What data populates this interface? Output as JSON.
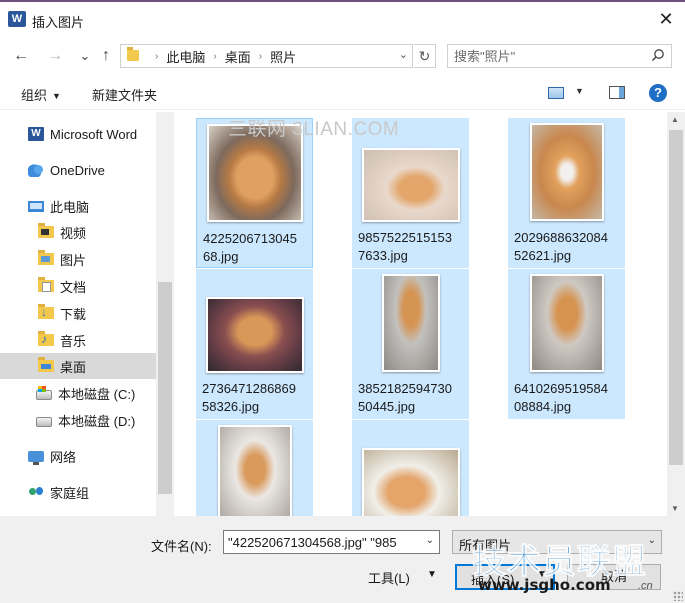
{
  "window": {
    "title": "插入图片",
    "close_glyph": "✕"
  },
  "address_bar": {
    "back_glyph": "←",
    "forward_glyph": "→",
    "recent_glyph": "⌄",
    "up_glyph": "↑",
    "breadcrumbs": [
      "此电脑",
      "桌面",
      "照片"
    ],
    "separator": "›",
    "dropdown_glyph": "⌄",
    "refresh_glyph": "↻"
  },
  "search": {
    "placeholder": "搜索\"照片\""
  },
  "toolbar": {
    "organize_label": "组织",
    "new_folder_label": "新建文件夹",
    "help_label": "?"
  },
  "sidebar": {
    "items": [
      {
        "label": "Microsoft Word",
        "icon": "word-icon"
      },
      {
        "label": "OneDrive",
        "icon": "onedrive-icon"
      },
      {
        "label": "此电脑",
        "icon": "computer-icon"
      },
      {
        "label": "视频",
        "icon": "videos-folder-icon"
      },
      {
        "label": "图片",
        "icon": "pictures-folder-icon"
      },
      {
        "label": "文档",
        "icon": "documents-folder-icon"
      },
      {
        "label": "下载",
        "icon": "downloads-folder-icon"
      },
      {
        "label": "音乐",
        "icon": "music-folder-icon"
      },
      {
        "label": "桌面",
        "icon": "desktop-folder-icon",
        "selected": true
      },
      {
        "label": "本地磁盘 (C:)",
        "icon": "windows-drive-icon"
      },
      {
        "label": "本地磁盘 (D:)",
        "icon": "drive-icon"
      },
      {
        "label": "网络",
        "icon": "network-icon"
      },
      {
        "label": "家庭组",
        "icon": "homegroup-icon"
      }
    ]
  },
  "files": [
    {
      "name": "422520671304568.jpg",
      "line1": "4225206713045",
      "line2": "68.jpg",
      "selected": true,
      "focused": true
    },
    {
      "name": "98575225151537633.jpg",
      "line1": "9857522515153",
      "line2": "7633.jpg",
      "selected": true
    },
    {
      "name": "202968863208452621.jpg",
      "line1": "2029688632084",
      "line2": "52621.jpg",
      "selected": true
    },
    {
      "name": "273647128686958326.jpg",
      "line1": "2736471286869",
      "line2": "58326.jpg",
      "selected": true
    },
    {
      "name": "385218259473050445.jpg",
      "line1": "3852182594730",
      "line2": "50445.jpg",
      "selected": true
    },
    {
      "name": "641026951958408884.jpg",
      "line1": "6410269519584",
      "line2": "08884.jpg",
      "selected": true
    },
    {
      "name": "",
      "line1": "",
      "line2": "",
      "selected": true
    },
    {
      "name": "",
      "line1": "",
      "line2": "",
      "selected": true
    }
  ],
  "watermark_top": "三联网 3LIAN.COM",
  "bottom": {
    "filename_label": "文件名(N):",
    "filename_value": "\"422520671304568.jpg\" \"985",
    "filetype_value": "所有图片",
    "tools_label": "工具(L)",
    "insert_label": "插入(S)",
    "cancel_label": "取消"
  },
  "watermark_logo": {
    "text": "技术员联盟",
    "url": "www.jsgho.com",
    "tld": ".cn"
  },
  "colors": {
    "selection": "#cce8ff",
    "selection_border": "#99d1ff",
    "accent": "#0078d7",
    "word_blue": "#2b579a"
  }
}
